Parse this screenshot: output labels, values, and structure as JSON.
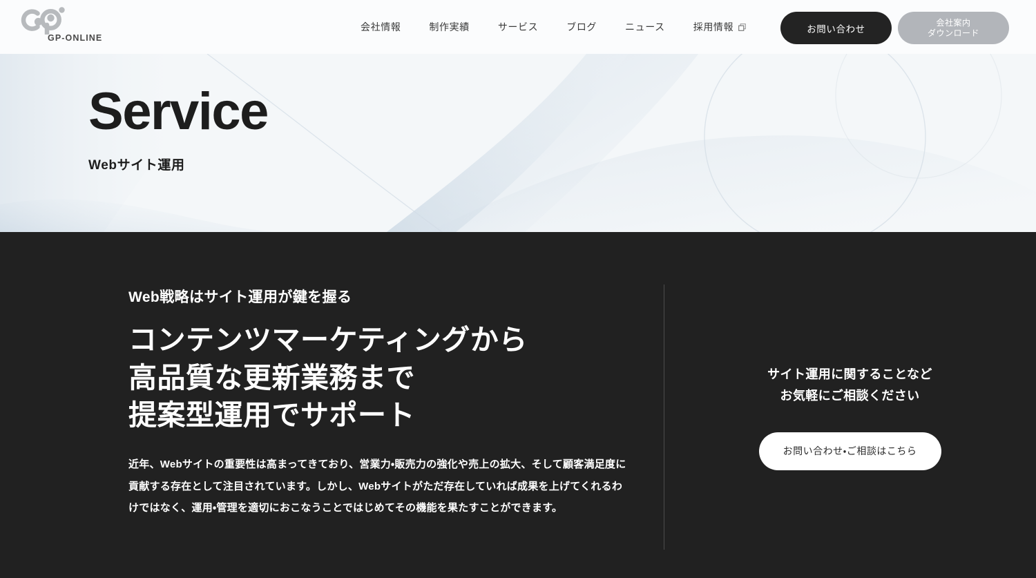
{
  "header": {
    "logo": {
      "icon": "gp-logo-mark",
      "wordmark": "GP-ONLINE"
    },
    "nav": [
      {
        "label": "会社情報",
        "icon": null
      },
      {
        "label": "制作実績",
        "icon": null
      },
      {
        "label": "サービス",
        "icon": null
      },
      {
        "label": "ブログ",
        "icon": null
      },
      {
        "label": "ニュース",
        "icon": null
      },
      {
        "label": "採用情報",
        "icon": "external-link-icon"
      }
    ],
    "contact_button": "お問い合わせ",
    "download_button": {
      "line1": "会社案内",
      "line2": "ダウンロード"
    }
  },
  "hero": {
    "title": "Service",
    "subtitle": "Webサイト運用"
  },
  "main": {
    "eyebrow": "Web戦略はサイト運用が鍵を握る",
    "headline_line1": "コンテンツマーケティングから",
    "headline_line2": "高品質な更新業務まで",
    "headline_line3": "提案型運用でサポート",
    "body": "近年、Webサイトの重要性は高まってきており、営業力・販売力の強化や売上の拡大、そして顧客満足度に貢献する存在として注目されています。しかし、Webサイトがただ存在していれば成果を上げてくれるわけではなく、運用・管理を適切におこなうことではじめてその機能を果たすことができます。",
    "cta": {
      "lead_line1": "サイト運用に関することなど",
      "lead_line2": "お気軽にご相談ください",
      "button": "お問い合わせ・ご相談はこちら"
    }
  },
  "colors": {
    "dark_bg": "#212121",
    "header_bg": "#fbfcfd",
    "hero_tint": "#dfe6ec",
    "accent_dark": "#232323",
    "accent_gray": "#b2b5ba",
    "divider": "#4c4c4c",
    "text_light": "#ffffff",
    "text_dark": "#1d1d1d"
  }
}
